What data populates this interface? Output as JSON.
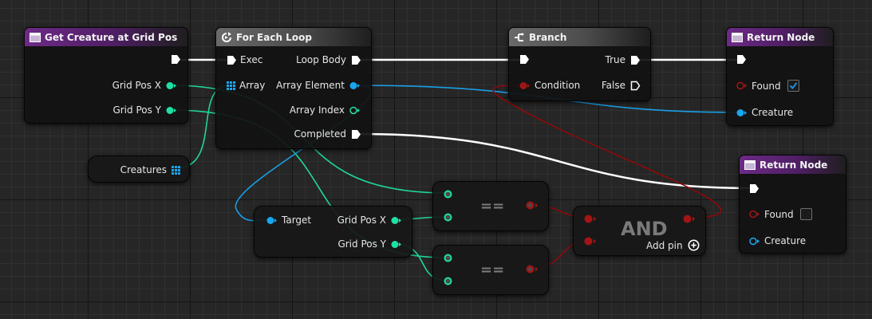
{
  "nodes": {
    "get_creature": {
      "title": "Get Creature at Grid Pos",
      "pins": {
        "grid_x": "Grid Pos X",
        "grid_y": "Grid Pos Y"
      }
    },
    "for_each": {
      "title": "For Each Loop",
      "pins": {
        "exec": "Exec",
        "array": "Array",
        "loop_body": "Loop Body",
        "array_element": "Array Element",
        "array_index": "Array Index",
        "completed": "Completed"
      }
    },
    "branch": {
      "title": "Branch",
      "pins": {
        "condition": "Condition",
        "true": "True",
        "false": "False"
      }
    },
    "return1": {
      "title": "Return Node",
      "pins": {
        "found": "Found",
        "creature": "Creature"
      },
      "found_checked": true
    },
    "return2": {
      "title": "Return Node",
      "pins": {
        "found": "Found",
        "creature": "Creature"
      },
      "found_checked": false
    },
    "creatures_var": {
      "label": "Creatures"
    },
    "target_getter": {
      "pins": {
        "target": "Target",
        "grid_x": "Grid Pos X",
        "grid_y": "Grid Pos Y"
      }
    },
    "equal1": {
      "symbol": "=="
    },
    "equal2": {
      "symbol": "=="
    },
    "and_node": {
      "symbol": "AND",
      "add_pin": "Add pin"
    }
  },
  "colors": {
    "exec": "#ffffff",
    "integer": "#1fe0a4",
    "object": "#19a6f0",
    "boolean": "#8c0a0a",
    "function_header": "#6d2a86",
    "macro_header": "#6a6a6a"
  },
  "icons": {
    "function": "function-icon",
    "loop": "loop-icon",
    "branch": "branch-icon",
    "array": "array-grid-icon",
    "add": "add-pin-icon",
    "check": "checkmark-icon"
  }
}
